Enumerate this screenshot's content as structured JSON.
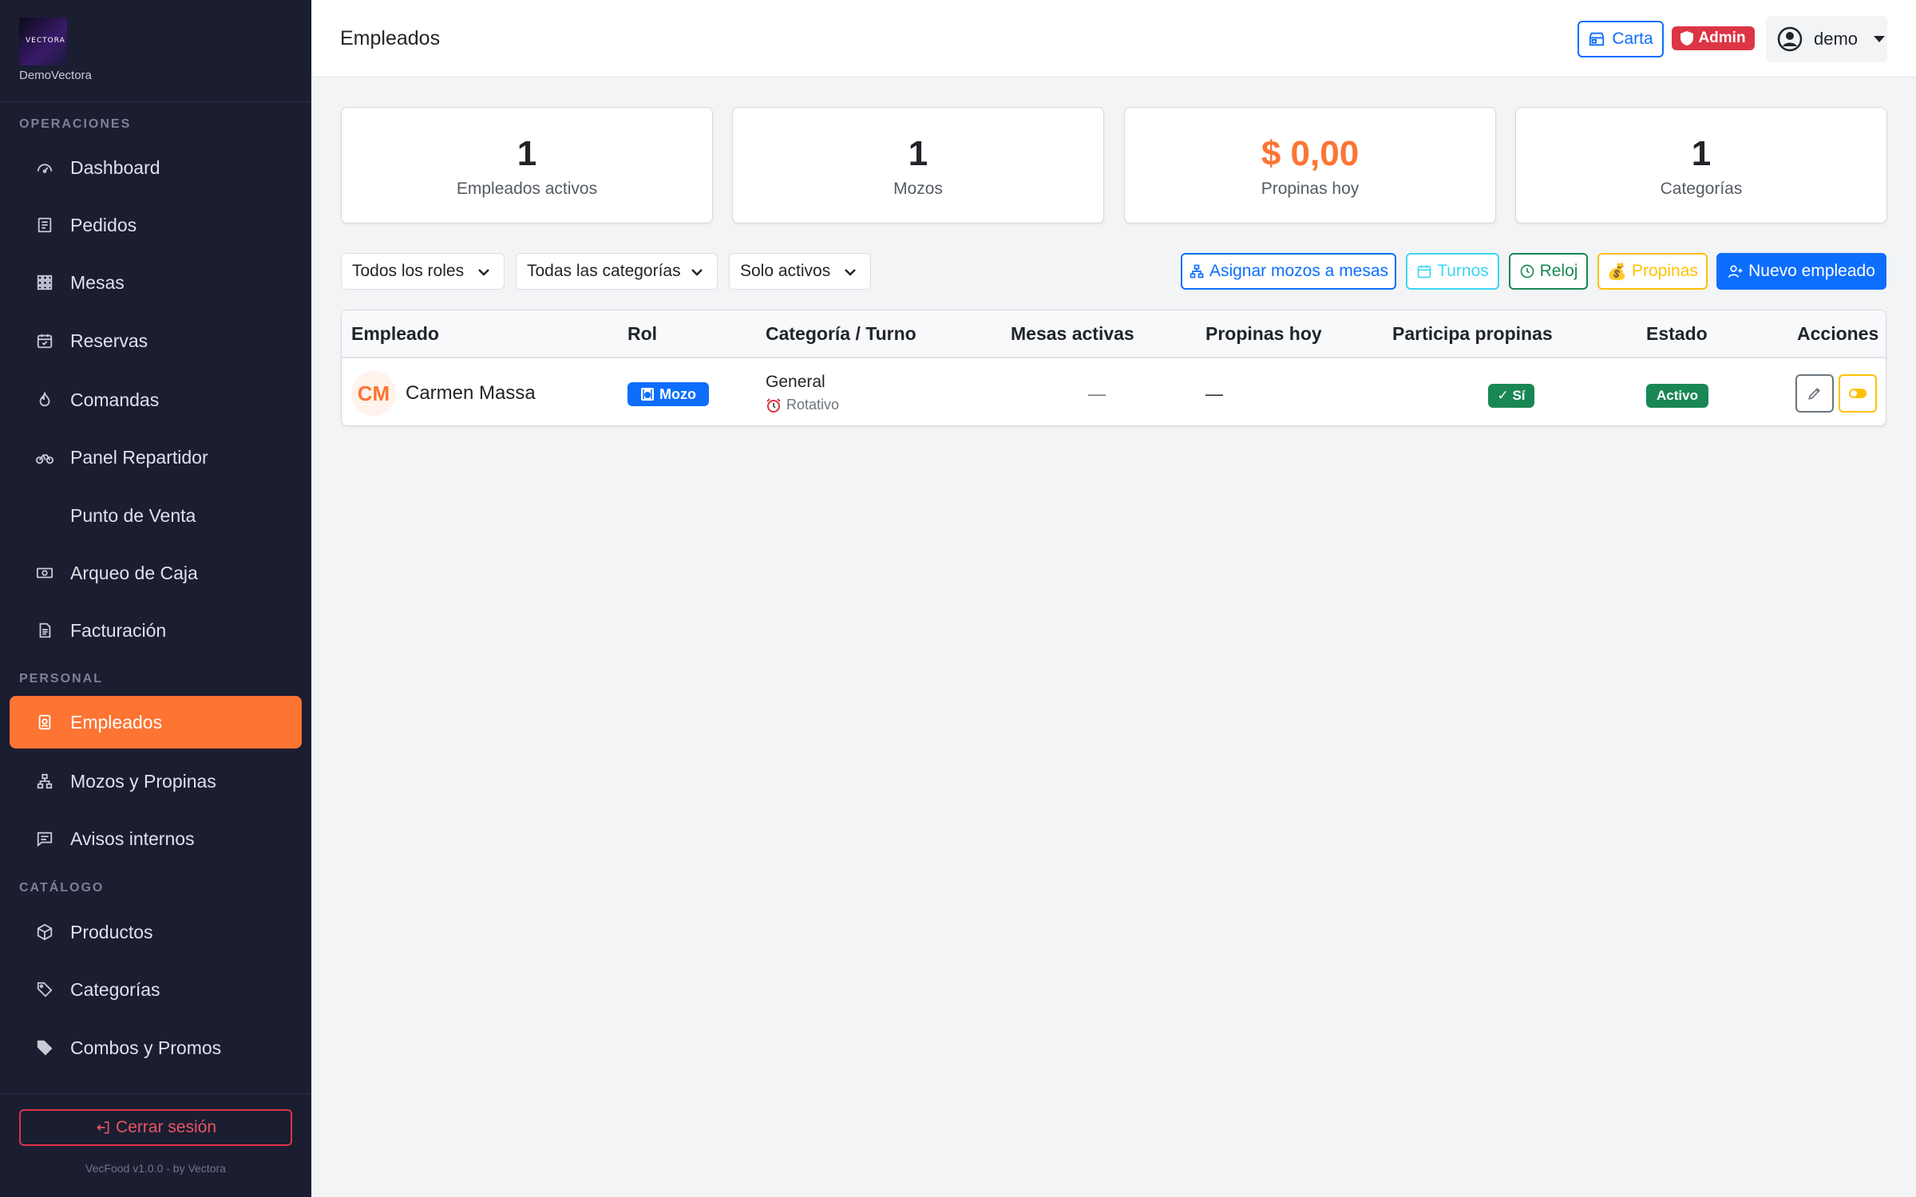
{
  "brand": {
    "logo_text": "VECTORA",
    "name": "DemoVectora"
  },
  "sidebar": {
    "sections": [
      {
        "label": "OPERACIONES"
      },
      {
        "label": "PERSONAL"
      },
      {
        "label": "CATÁLOGO"
      }
    ],
    "items": [
      {
        "label": "Dashboard",
        "icon": "speedometer-icon"
      },
      {
        "label": "Pedidos",
        "icon": "receipt-icon"
      },
      {
        "label": "Mesas",
        "icon": "grid-icon"
      },
      {
        "label": "Reservas",
        "icon": "calendar-check-icon"
      },
      {
        "label": "Comandas",
        "icon": "fire-icon"
      },
      {
        "label": "Panel Repartidor",
        "icon": "bicycle-icon"
      },
      {
        "label": "Punto de Venta",
        "icon": ""
      },
      {
        "label": "Arqueo de Caja",
        "icon": "cash-icon"
      },
      {
        "label": "Facturación",
        "icon": "file-text-icon"
      },
      {
        "label": "Empleados",
        "icon": "person-badge-icon",
        "active": true
      },
      {
        "label": "Mozos y Propinas",
        "icon": "diagram-icon"
      },
      {
        "label": "Avisos internos",
        "icon": "chat-icon"
      },
      {
        "label": "Productos",
        "icon": "box-icon"
      },
      {
        "label": "Categorías",
        "icon": "tags-icon"
      },
      {
        "label": "Combos y Promos",
        "icon": "tag-icon"
      }
    ],
    "logout_label": "Cerrar sesión",
    "version": "VecFood v1.0.0 - by Vectora"
  },
  "header": {
    "title": "Empleados",
    "carta_label": "Carta",
    "admin_label": "Admin",
    "user_label": "demo"
  },
  "stats": [
    {
      "value": "1",
      "label": "Empleados activos"
    },
    {
      "value": "1",
      "label": "Mozos"
    },
    {
      "value": "$ 0,00",
      "label": "Propinas hoy"
    },
    {
      "value": "1",
      "label": "Categorías"
    }
  ],
  "filters": {
    "role": "Todos los roles",
    "category": "Todas las categorías",
    "status": "Solo activos"
  },
  "actions": {
    "assign_label": "Asignar mozos a mesas",
    "shifts_label": "Turnos",
    "clock_label": "Reloj",
    "tips_label": "Propinas",
    "new_label": "Nuevo empleado"
  },
  "table": {
    "columns": [
      "Empleado",
      "Rol",
      "Categoría / Turno",
      "Mesas activas",
      "Propinas hoy",
      "Participa propinas",
      "Estado",
      "Acciones"
    ],
    "rows": [
      {
        "initials": "CM",
        "name": "Carmen Massa",
        "role": "Mozo",
        "category": "General",
        "shift": "Rotativo",
        "active_tables": "—",
        "tips_today": "—",
        "participates": "✓ Sí",
        "status": "Activo"
      }
    ]
  },
  "colors": {
    "accent": "#fd7433",
    "sidebar_bg": "#1b1d31",
    "primary": "#0d6efd",
    "success": "#198754",
    "danger": "#dc3545",
    "warning": "#ffc107",
    "info": "#3dd5f3"
  }
}
